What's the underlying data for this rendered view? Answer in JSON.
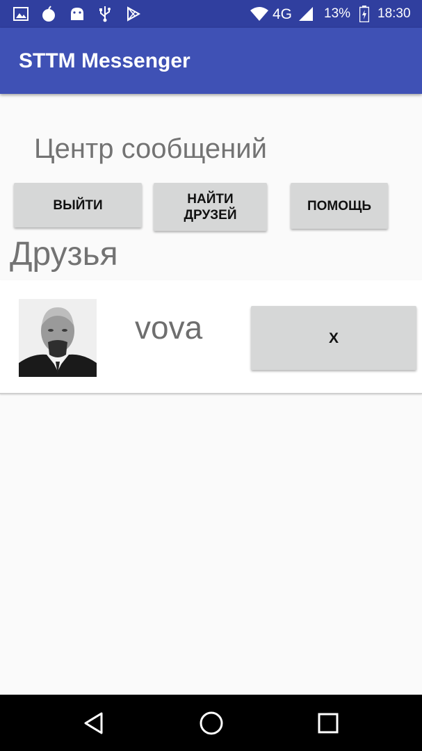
{
  "status_bar": {
    "network": "4G",
    "battery": "13%",
    "time": "18:30",
    "icons": [
      "image-icon",
      "bomb-icon",
      "android-icon",
      "usb-icon",
      "play-store-icon",
      "wifi-icon",
      "signal-icon",
      "battery-icon"
    ]
  },
  "app_bar": {
    "title": "STTM Messenger"
  },
  "main": {
    "center_title": "Центр сообщений",
    "buttons": {
      "logout": "ВЫЙТИ",
      "find_friends": "НАЙТИ\nДРУЗЕЙ",
      "help": "ПОМОЩЬ"
    },
    "friends_title": "Друзья",
    "friends": [
      {
        "name": "vova",
        "remove_label": "X"
      }
    ]
  },
  "nav_bar": {
    "icons": [
      "back-icon",
      "home-icon",
      "recents-icon"
    ]
  },
  "colors": {
    "status_bar": "#303f9f",
    "app_bar": "#3f51b5",
    "button": "#d6d7d7",
    "background": "#fafafa"
  }
}
